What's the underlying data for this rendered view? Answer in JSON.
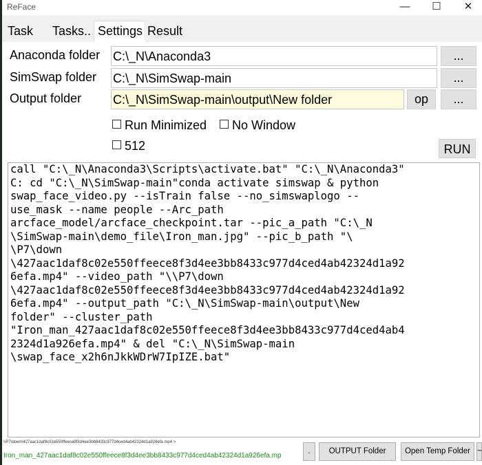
{
  "window": {
    "title": "ReFace",
    "minimize_glyph": "—",
    "maximize_glyph": "☐",
    "close_glyph": "✕"
  },
  "tabs": [
    {
      "label": "Task"
    },
    {
      "label": "Tasks.."
    },
    {
      "label": "Settings"
    },
    {
      "label": "Result"
    }
  ],
  "settings": {
    "anaconda_label": "Anaconda folder",
    "anaconda_value": "C:\\_N\\Anaconda3",
    "simswap_label": "SimSwap folder",
    "simswap_value": "C:\\_N\\SimSwap-main",
    "output_label": "Output folder",
    "output_value": "C:\\_N\\SimSwap-main\\output\\New folder",
    "browse_label": "...",
    "op_label": "op",
    "run_minimized_label": "Run Minimized",
    "no_window_label": "No Window",
    "size_512_label": "512",
    "run_label": "RUN"
  },
  "command_text": "call \"C:\\_N\\Anaconda3\\Scripts\\activate.bat\" \"C:\\_N\\Anaconda3\"\nC: cd \"C:\\_N\\SimSwap-main\"conda activate simswap & python\nswap_face_video.py --isTrain false --no_simswaplogo --\nuse_mask --name people --Arc_path\narcface_model/arcface_checkpoint.tar --pic_a_path \"C:\\_N\n\\SimSwap-main\\demo_file\\Iron_man.jpg\" --pic_b_path \"\\\n\\P7\\down\n\\427aac1daf8c02e550ffeece8f3d4ee3bb8433c977d4ced4ab42324d1a92\n6efa.mp4\" --video_path \"\\\\P7\\down\n\\427aac1daf8c02e550ffeece8f3d4ee3bb8433c977d4ced4ab42324d1a92\n6efa.mp4\" --output_path \"C:\\_N\\SimSwap-main\\output\\New\nfolder\" --cluster_path\n\"Iron_man_427aac1daf8c02e550ffeece8f3d4ee3bb8433c977d4ced4ab4\n2324d1a926efa.mp4\" & del \"C:\\_N\\SimSwap-main\n\\swap_face_x2h6nJkkWDrW7IpIZE.bat\"",
  "status": {
    "path_line": "\\\\P7\\down\\427aac1daf8c02e550ffeece8f3d4ee3bb8433c977d4ced4ab42324d1a926efa.mp4 >",
    "file_line": "Iron_man_427aac1daf8c02e550ffeece8f3d4ee3bb8433c977d4ced4ab42324d1a926efa.mp",
    "dot_label": ".",
    "output_folder_label": "OUTPUT Folder",
    "open_temp_label": "Open Temp Folder",
    "extra_label": "~"
  },
  "colors": {
    "highlight_field": "#fffbdc",
    "status_green": "#1a8a1a"
  }
}
